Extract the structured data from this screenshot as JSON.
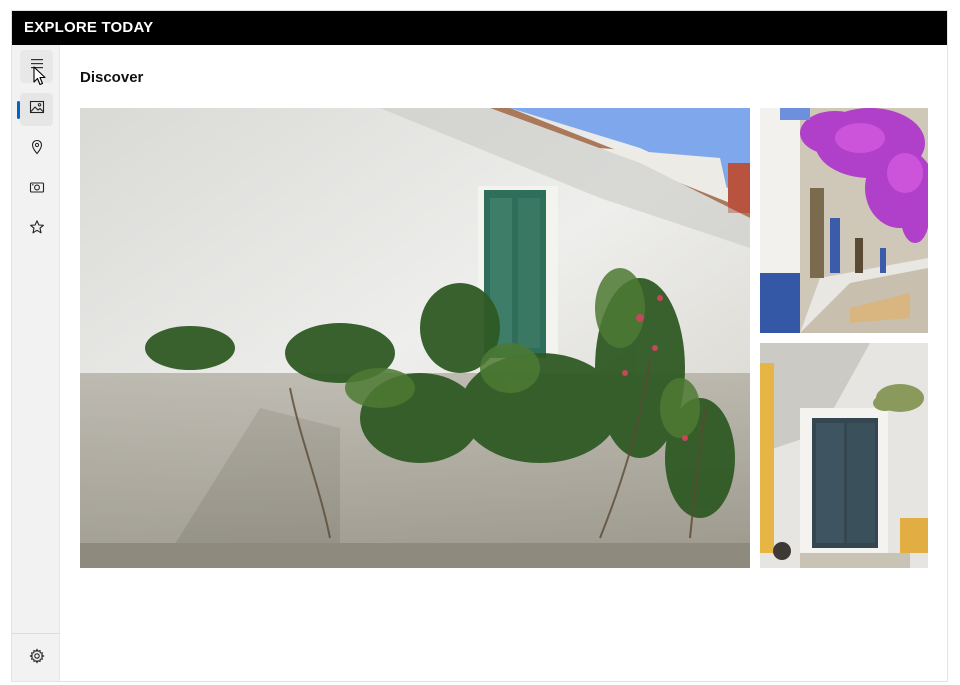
{
  "app": {
    "title": "EXPLORE TODAY"
  },
  "nav": {
    "menu_icon": "hamburger-icon",
    "items": [
      {
        "id": "photos",
        "icon": "image-icon",
        "selected": true
      },
      {
        "id": "places",
        "icon": "location-pin-icon",
        "selected": false
      },
      {
        "id": "camera",
        "icon": "camera-icon",
        "selected": false
      },
      {
        "id": "favorites",
        "icon": "star-icon",
        "selected": false
      }
    ],
    "footer_icon": "gear-icon"
  },
  "page": {
    "title": "Discover"
  },
  "gallery": {
    "photos": [
      {
        "id": "main",
        "subject": "whitewashed-wall-green-door-plants"
      },
      {
        "id": "side-top",
        "subject": "street-with-bougainvillea"
      },
      {
        "id": "side-bottom",
        "subject": "blue-door-white-wall"
      }
    ]
  },
  "colors": {
    "titlebar": "#000000",
    "rail": "#f2f2f2",
    "accent": "#0067c0"
  }
}
